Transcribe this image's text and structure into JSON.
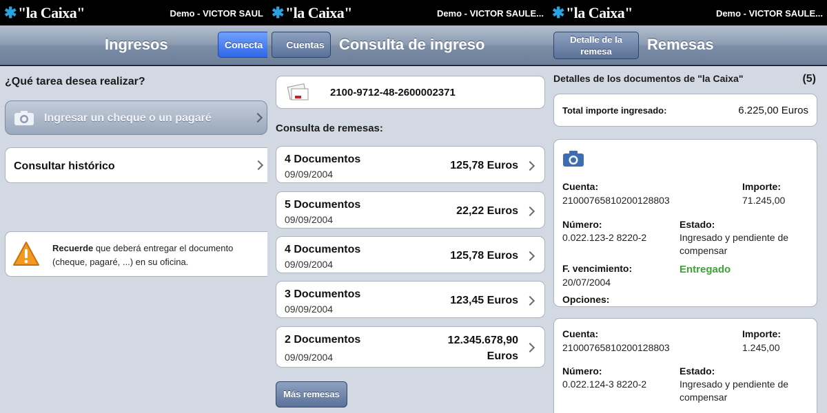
{
  "colors": {
    "accent_blue": "#2f67e6",
    "nav_gray": "#7c8ea6",
    "status_green": "#3ca334",
    "logo_star": "#2aa1e0"
  },
  "brand": {
    "logo_text": "\"la Caixa\""
  },
  "panel1": {
    "status_user": "Demo - VICTOR SAUL",
    "nav_title": "Ingresos",
    "connect_button": "Conecta",
    "question": "¿Qué tarea desea realizar?",
    "primary_action": "Ingresar un cheque o un pagaré",
    "history_action": "Consultar histórico",
    "notice_bold": "Recuerde",
    "notice_line1": " que deberá entregar el documento",
    "notice_line2": "(cheque, pagaré, ...) en su oficina."
  },
  "panel2": {
    "status_user": "Demo - VICTOR SAULE...",
    "back_button": "Cuentas",
    "nav_title": "Consulta de ingreso",
    "account_number": "2100-9712-48-2600002371",
    "section_title": "Consulta de remesas:",
    "remesas": [
      {
        "docs": "4 Documentos",
        "date": "09/09/2004",
        "amount": "125,78 Euros"
      },
      {
        "docs": "5 Documentos",
        "date": "09/09/2004",
        "amount": "22,22 Euros"
      },
      {
        "docs": "4 Documentos",
        "date": "09/09/2004",
        "amount": "125,78 Euros"
      },
      {
        "docs": "3 Documentos",
        "date": "09/09/2004",
        "amount": "123,45 Euros"
      },
      {
        "docs": "2 Documentos",
        "date": "09/09/2004",
        "amount": "12.345.678,90 Euros"
      }
    ],
    "more_button": "Más remesas"
  },
  "panel3": {
    "status_user": "Demo - VICTOR SAULE...",
    "back_button_line1": "Detalle de la",
    "back_button_line2": "remesa",
    "nav_title": "Remesas",
    "details_title": "Detalles de los documentos  de \"la Caixa\"",
    "details_count": "(5)",
    "total_label": "Total importe ingresado:",
    "total_value": "6.225,00 Euros",
    "labels": {
      "cuenta": "Cuenta:",
      "importe": "Importe:",
      "numero": "Número:",
      "estado": "Estado:",
      "vencimiento": "F. vencimiento:",
      "opciones": "Opciones:"
    },
    "doc1": {
      "cuenta": "21000765810200128803",
      "importe": "71.245,00",
      "numero": "0.022.123-2 8220-2",
      "estado_line1": "Ingresado y pendiente de",
      "estado_line2": "compensar",
      "vencimiento": "20/07/2004",
      "estado2": "Entregado"
    },
    "doc2": {
      "cuenta": "21000765810200128803",
      "importe": "1.245,00",
      "numero": "0.022.124-3 8220-2",
      "estado_line1": "Ingresado y pendiente de",
      "estado_line2": "compensar"
    }
  }
}
